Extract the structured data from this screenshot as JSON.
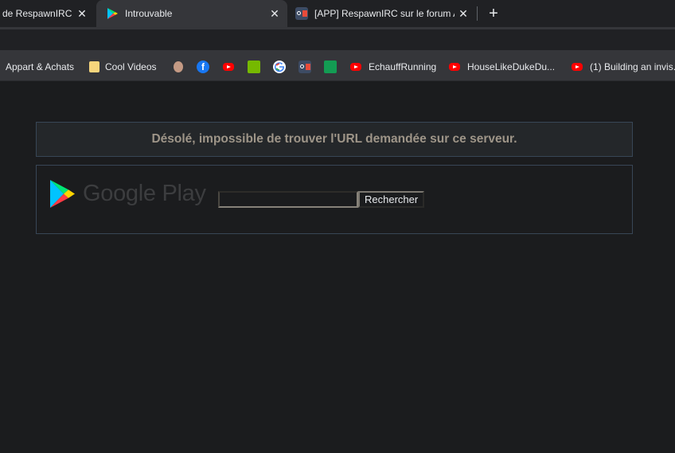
{
  "tabs": [
    {
      "title": "de RespawnIRC, j",
      "active": false,
      "close": "✕"
    },
    {
      "title": "Introuvable",
      "active": true,
      "close": "✕"
    },
    {
      "title": "[APP] RespawnIRC sur le forum A",
      "active": false,
      "close": "✕"
    }
  ],
  "new_tab_label": "+",
  "bookmarks": [
    {
      "label": "Appart & Achats",
      "icon": "none"
    },
    {
      "label": "Cool Videos",
      "icon": "folder-icon"
    },
    {
      "label": "",
      "icon": "avatar-icon"
    },
    {
      "label": "",
      "icon": "facebook-icon",
      "glyph": "f"
    },
    {
      "label": "",
      "icon": "youtube-icon"
    },
    {
      "label": "",
      "icon": "nvidia-icon"
    },
    {
      "label": "",
      "icon": "google-icon"
    },
    {
      "label": "",
      "icon": "respawnirc-icon"
    },
    {
      "label": "",
      "icon": "bnp-icon"
    },
    {
      "label": "EchauffRunning",
      "icon": "youtube-icon"
    },
    {
      "label": "HouseLikeDukeDu...",
      "icon": "youtube-icon"
    },
    {
      "label": "(1) Building an invis...",
      "icon": "youtube-icon"
    }
  ],
  "page": {
    "error_message": "Désolé, impossible de trouver l'URL demandée sur ce serveur.",
    "logo_text": "Google Play",
    "search_value": "",
    "search_button": "Rechercher"
  },
  "colors": {
    "background": "#1b1c1e",
    "border": "#384656",
    "error_text": "#9e9588"
  }
}
